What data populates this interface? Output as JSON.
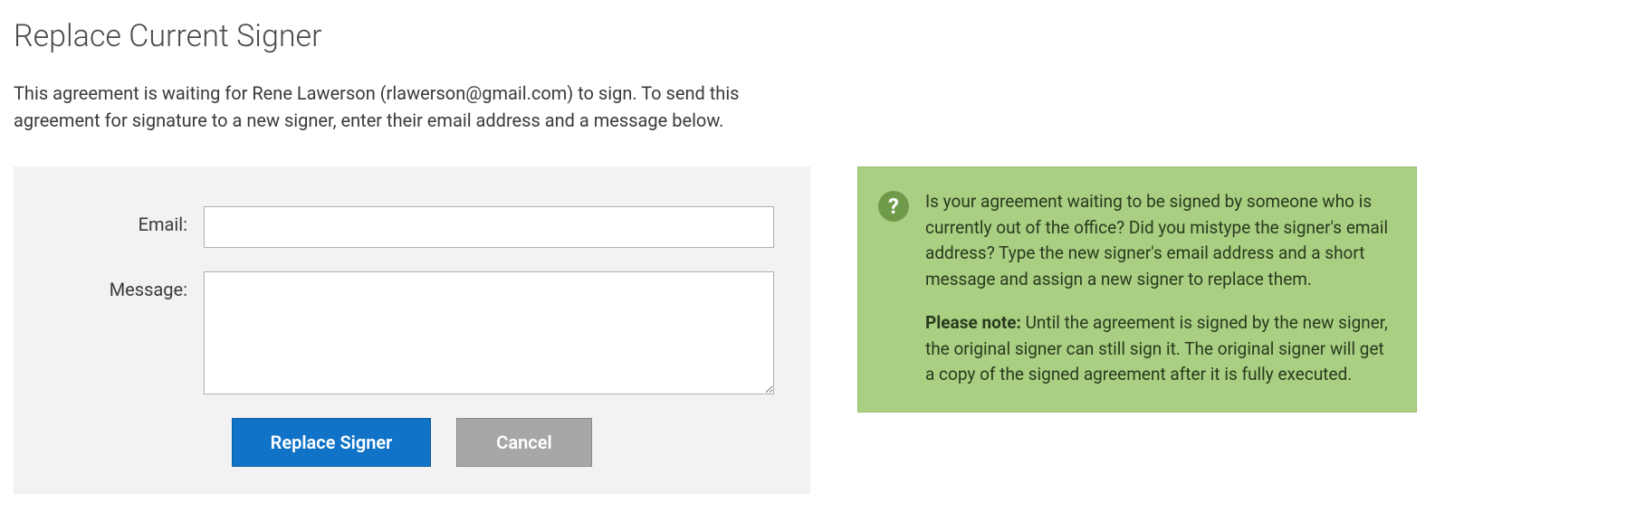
{
  "title": "Replace Current Signer",
  "description": "This agreement is waiting for Rene Lawerson (rlawerson@gmail.com) to sign. To send this agreement for signature to a new signer, enter their email address and a message below.",
  "form": {
    "email_label": "Email:",
    "email_value": "",
    "message_label": "Message:",
    "message_value": "",
    "replace_button": "Replace Signer",
    "cancel_button": "Cancel"
  },
  "help": {
    "icon_glyph": "?",
    "paragraph1": "Is your agreement waiting to be signed by someone who is currently out of the office? Did you mistype the signer's email address? Type the new signer's email address and a short message and assign a new signer to replace them.",
    "note_label": "Please note:",
    "note_text": " Until the agreement is signed by the new signer, the original signer can still sign it. The original signer will get a copy of the signed agreement after it is fully executed."
  }
}
